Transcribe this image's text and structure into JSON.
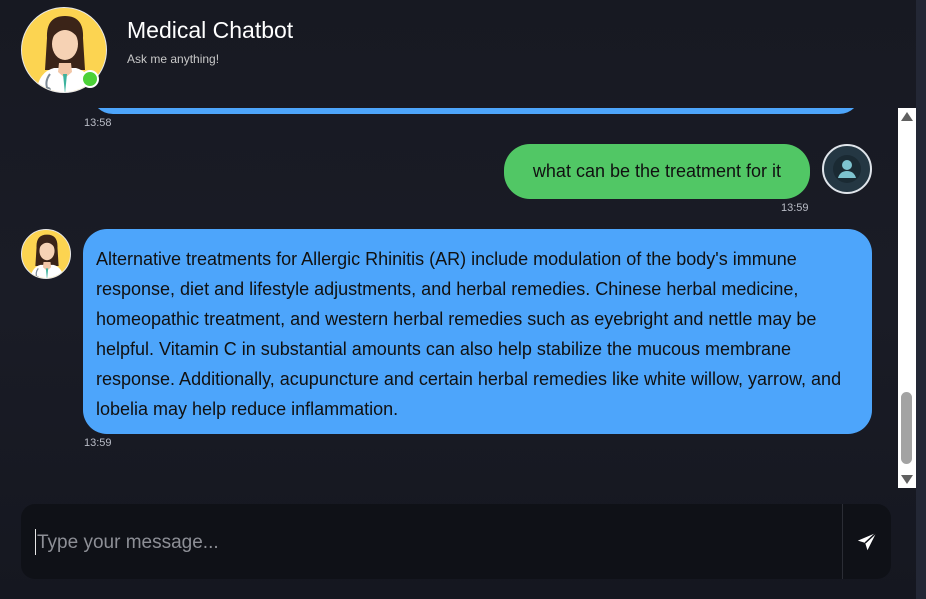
{
  "header": {
    "title": "Medical Chatbot",
    "subtitle": "Ask me anything!",
    "status": "online",
    "status_color": "#4cd137"
  },
  "messages": [
    {
      "sender": "bot",
      "text": "",
      "time": "13:58",
      "bubble_color": "#4da5fb"
    },
    {
      "sender": "user",
      "text": "what can be the treatment for it",
      "time": "13:59",
      "bubble_color": "#51c765"
    },
    {
      "sender": "bot",
      "text": "Alternative treatments for Allergic Rhinitis (AR) include modulation of the body's immune response, diet and lifestyle adjustments, and herbal remedies. Chinese herbal medicine, homeopathic treatment, and western herbal remedies such as eyebright and nettle may be helpful. Vitamin C in substantial amounts can also help stabilize the mucous membrane response. Additionally, acupuncture and certain herbal remedies like white willow, yarrow, and lobelia may help reduce inflammation.",
      "time": "13:59",
      "bubble_color": "#4da5fb"
    }
  ],
  "input": {
    "placeholder": "Type your message...",
    "value": ""
  },
  "icons": {
    "send": "send-icon",
    "user_avatar": "user-icon",
    "bot_avatar": "doctor-avatar"
  }
}
